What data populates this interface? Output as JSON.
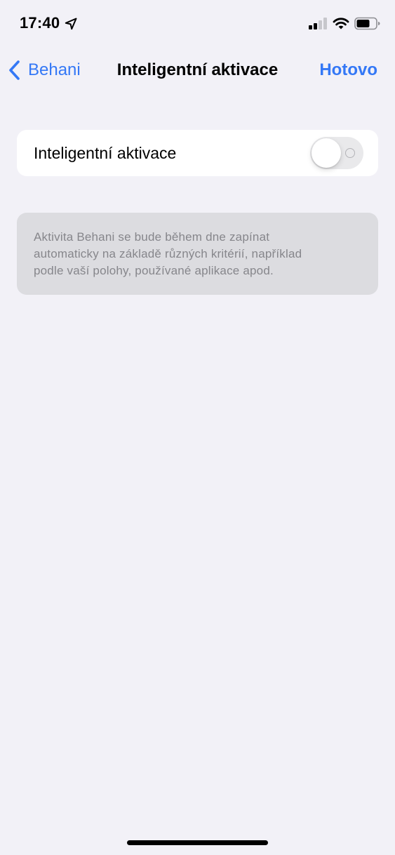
{
  "status_bar": {
    "time": "17:40"
  },
  "nav": {
    "back_label": "Behani",
    "title": "Inteligentní aktivace",
    "done_label": "Hotovo"
  },
  "setting": {
    "label": "Inteligentní aktivace",
    "enabled": false
  },
  "info": {
    "lines": [
      "Aktivita Behani se bude během dne zapínat",
      "automaticky na základě různých kritérií, například",
      "podle vaší polohy, používané aplikace apod."
    ]
  },
  "colors": {
    "accent": "#3478f6",
    "background": "#f2f1f7",
    "info_background": "#dcdce0",
    "info_text": "#86868b",
    "toggle_off": "#e9e9eb"
  }
}
